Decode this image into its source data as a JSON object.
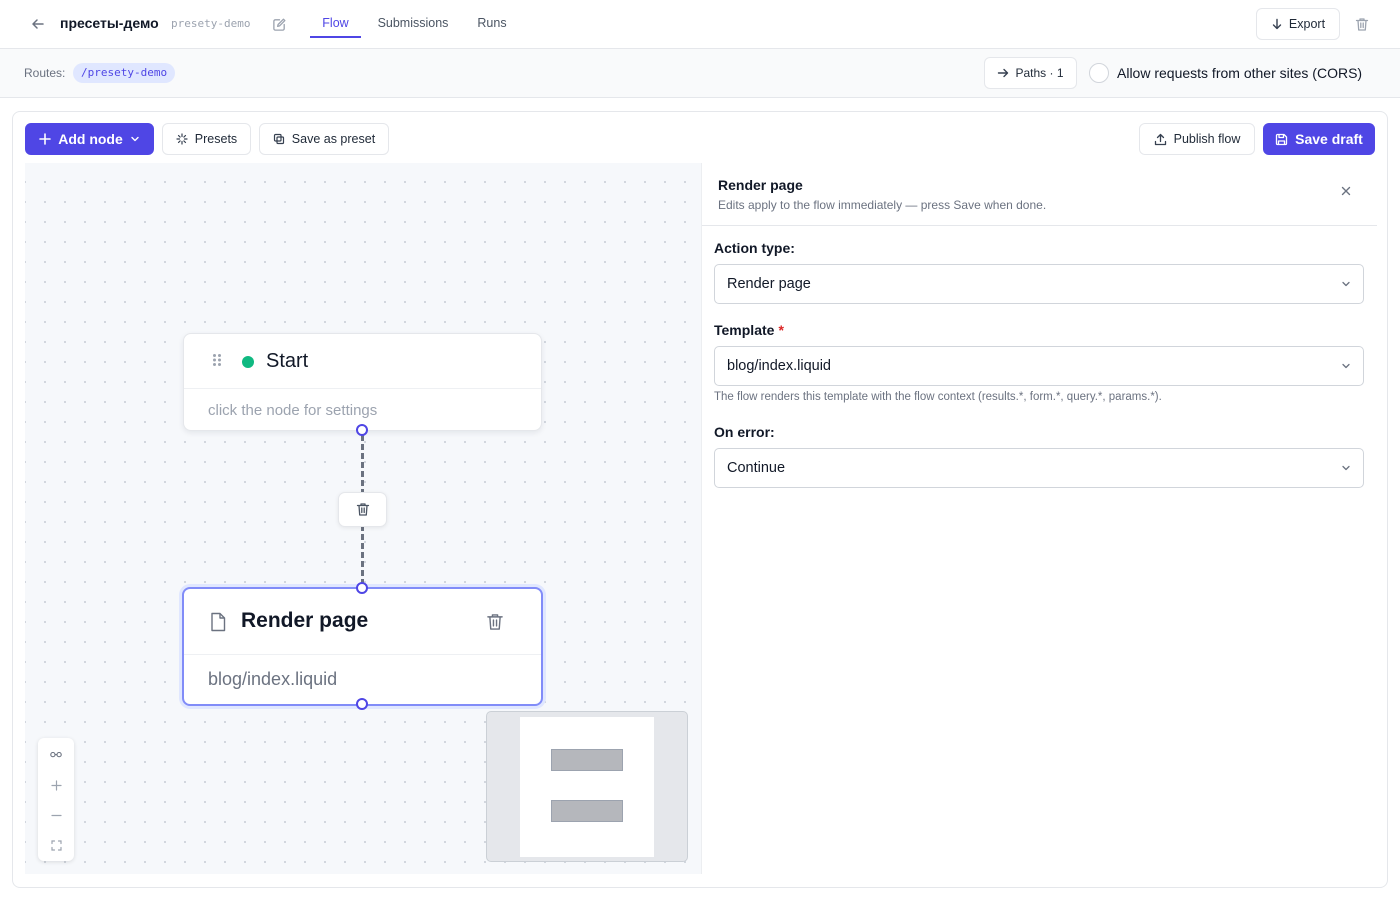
{
  "header": {
    "flow_title": "пресеты-демо",
    "flow_slug": "presety-demo",
    "tabs": [
      {
        "label": "Flow",
        "active": true
      },
      {
        "label": "Submissions",
        "active": false
      },
      {
        "label": "Runs",
        "active": false
      }
    ],
    "export_label": "Export"
  },
  "routes": {
    "label": "Routes:",
    "route": "/presety-demo",
    "paths_label": "Paths · 1",
    "cors_label": "Allow requests from other sites (CORS)",
    "cors_checked": false
  },
  "toolbar": {
    "add_node_label": "Add node",
    "presets_label": "Presets",
    "save_preset_label": "Save as preset",
    "publish_label": "Publish flow",
    "save_draft_label": "Save draft"
  },
  "canvas": {
    "start_node": {
      "title": "Start",
      "hint": "click the node for settings"
    },
    "render_node": {
      "title": "Render page",
      "template": "blog/index.liquid"
    }
  },
  "panel": {
    "title": "Render page",
    "subtitle": "Edits apply to the flow immediately — press Save when done.",
    "action_type_label": "Action type:",
    "action_type_value": "Render page",
    "template_label": "Template",
    "required_mark": "*",
    "template_value": "blog/index.liquid",
    "template_help": "The flow renders this template with the flow context (results.*, form.*, query.*, params.*).",
    "on_error_label": "On error:",
    "on_error_value": "Continue"
  },
  "colors": {
    "accent": "#4f46e5",
    "status_green": "#10b981",
    "required_red": "#dc2626"
  },
  "icons": [
    "arrow-left-icon",
    "edit-icon",
    "download-icon",
    "trash-icon",
    "arrow-right-icon",
    "plus-icon",
    "chevron-down-icon",
    "sparkle-icon",
    "copy-icon",
    "upload-icon",
    "save-icon",
    "grip-icon",
    "file-icon",
    "close-icon",
    "fit-view-icon",
    "zoom-in-icon",
    "zoom-out-icon",
    "fullscreen-icon"
  ]
}
